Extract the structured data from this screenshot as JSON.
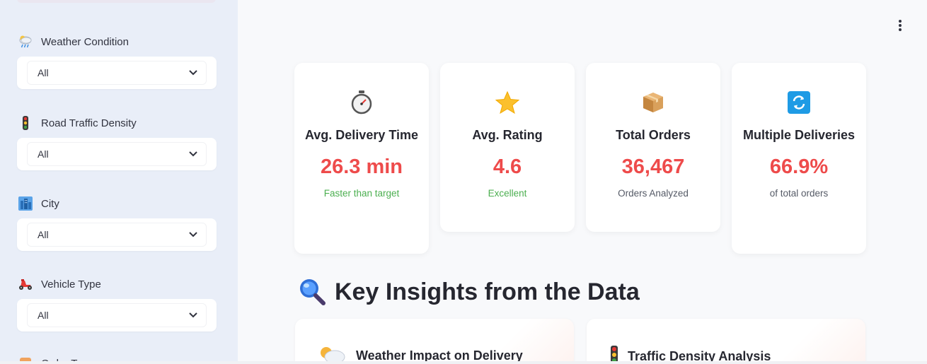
{
  "sidebar": {
    "filters": [
      {
        "label": "Weather Condition",
        "value": "All",
        "icon": "weather-icon"
      },
      {
        "label": "Road Traffic Density",
        "value": "All",
        "icon": "traffic-light-icon"
      },
      {
        "label": "City",
        "value": "All",
        "icon": "city-icon"
      },
      {
        "label": "Vehicle Type",
        "value": "All",
        "icon": "scooter-icon"
      }
    ],
    "partial_label": "Order Type"
  },
  "header": {
    "menu_icon": "kebab-menu-icon"
  },
  "metrics": [
    {
      "title": "Avg. Delivery Time",
      "value": "26.3 min",
      "sub": "Faster than target",
      "icon": "stopwatch-icon",
      "sub_color": "#4caf50"
    },
    {
      "title": "Avg. Rating",
      "value": "4.6",
      "sub": "Excellent",
      "icon": "star-icon",
      "sub_color": "#4caf50"
    },
    {
      "title": "Total Orders",
      "value": "36,467",
      "sub": "Orders Analyzed",
      "icon": "package-icon",
      "sub_color": "#555a66"
    },
    {
      "title": "Multiple Deliveries",
      "value": "66.9%",
      "sub": "of total orders",
      "icon": "repeat-icon",
      "sub_color": "#555a66"
    }
  ],
  "insights": {
    "title": "Key Insights from the Data",
    "cards": [
      {
        "title": "Weather Impact on Delivery",
        "icon": "weather-icon"
      },
      {
        "title": "Traffic Density Analysis",
        "icon": "traffic-light-icon"
      }
    ]
  },
  "colors": {
    "accent": "#ee4b4b",
    "positive": "#4caf50",
    "sidebar_bg": "#e9eef8"
  }
}
